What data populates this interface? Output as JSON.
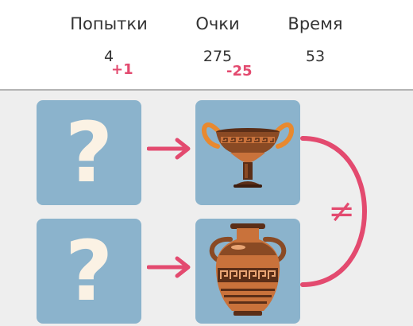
{
  "stats": {
    "attempts": {
      "label": "Попытки",
      "value": "4",
      "delta": "+1"
    },
    "points": {
      "label": "Очки",
      "value": "275",
      "delta": "-25"
    },
    "time": {
      "label": "Время",
      "value": "53"
    }
  },
  "board": {
    "hidden_card_symbol": "?",
    "relation_symbol": "≠",
    "cards": [
      {
        "position": "top-left",
        "state": "hidden",
        "content": "?"
      },
      {
        "position": "top-right",
        "state": "revealed",
        "icon": "greek-kylix-cup-icon"
      },
      {
        "position": "bottom-left",
        "state": "hidden",
        "content": "?"
      },
      {
        "position": "bottom-right",
        "state": "revealed",
        "icon": "greek-amphora-icon"
      }
    ]
  },
  "colors": {
    "card_background": "#8bb3cc",
    "accent": "#e34a6f",
    "question_mark": "#fbf2e4",
    "pottery_terracotta": "#c9723b",
    "pottery_dark": "#5b2e17"
  }
}
